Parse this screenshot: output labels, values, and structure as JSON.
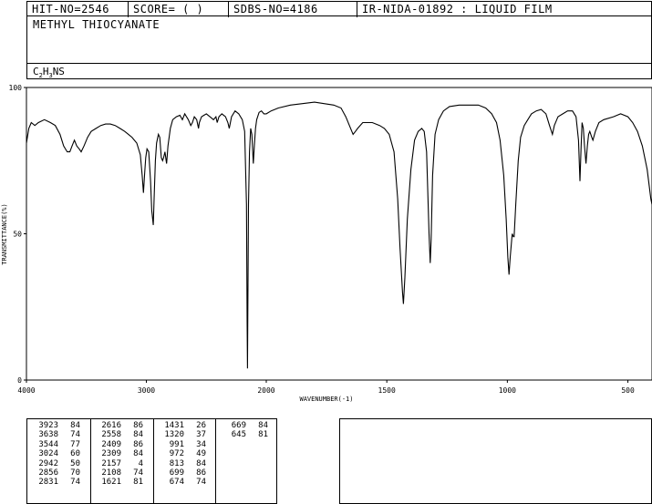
{
  "header": {
    "hit_no": "HIT-NO=2546",
    "score": "SCORE=  (   )",
    "sdbs_no": "SDBS-NO=4186",
    "ir_nida": "IR-NIDA-01892 : LIQUID FILM"
  },
  "compound_name": "METHYL THIOCYANATE",
  "formula": {
    "c": "C",
    "c_sub": "2",
    "h": "H",
    "h_sub": "3",
    "rest": "NS"
  },
  "chart_data": {
    "type": "line",
    "xlabel": "WAVENUMBER(-1)",
    "ylabel": "TRANSMITTANCE(%)",
    "xlim": [
      4000,
      400
    ],
    "ylim": [
      0,
      100
    ],
    "x_ticks": [
      {
        "value": 4000,
        "label": "4000"
      },
      {
        "value": 3000,
        "label": "3000"
      },
      {
        "value": 2000,
        "label": "2000"
      },
      {
        "value": 1500,
        "label": "1500"
      },
      {
        "value": 1000,
        "label": "1000"
      },
      {
        "value": 500,
        "label": "500"
      }
    ],
    "y_ticks": [
      {
        "value": 0,
        "label": "0"
      },
      {
        "value": 50,
        "label": "50"
      },
      {
        "value": 100,
        "label": "100"
      }
    ],
    "scale_note": "x axis: 4000-2000 at half scale of 2000-400",
    "series": [
      {
        "points": [
          [
            4000,
            81
          ],
          [
            3980,
            86
          ],
          [
            3960,
            88
          ],
          [
            3930,
            87
          ],
          [
            3900,
            88
          ],
          [
            3850,
            89
          ],
          [
            3800,
            88
          ],
          [
            3760,
            87
          ],
          [
            3720,
            84
          ],
          [
            3690,
            80
          ],
          [
            3660,
            78
          ],
          [
            3638,
            78
          ],
          [
            3620,
            80
          ],
          [
            3600,
            82
          ],
          [
            3580,
            80
          ],
          [
            3560,
            79
          ],
          [
            3544,
            78
          ],
          [
            3520,
            80
          ],
          [
            3490,
            83
          ],
          [
            3460,
            85
          ],
          [
            3420,
            86
          ],
          [
            3380,
            87
          ],
          [
            3340,
            87.5
          ],
          [
            3300,
            87.5
          ],
          [
            3260,
            87
          ],
          [
            3220,
            86
          ],
          [
            3180,
            85
          ],
          [
            3150,
            84
          ],
          [
            3120,
            83
          ],
          [
            3080,
            81
          ],
          [
            3050,
            77
          ],
          [
            3035,
            70
          ],
          [
            3024,
            64
          ],
          [
            3015,
            70
          ],
          [
            3005,
            76
          ],
          [
            2995,
            79
          ],
          [
            2980,
            78
          ],
          [
            2965,
            68
          ],
          [
            2955,
            58
          ],
          [
            2942,
            53
          ],
          [
            2935,
            62
          ],
          [
            2925,
            75
          ],
          [
            2915,
            81
          ],
          [
            2900,
            84
          ],
          [
            2888,
            83
          ],
          [
            2875,
            76
          ],
          [
            2865,
            75
          ],
          [
            2856,
            76
          ],
          [
            2845,
            78
          ],
          [
            2835,
            75
          ],
          [
            2831,
            74
          ],
          [
            2820,
            80
          ],
          [
            2800,
            86
          ],
          [
            2780,
            89
          ],
          [
            2750,
            90
          ],
          [
            2720,
            90.5
          ],
          [
            2700,
            89
          ],
          [
            2680,
            91
          ],
          [
            2650,
            89
          ],
          [
            2630,
            87
          ],
          [
            2616,
            88
          ],
          [
            2600,
            90
          ],
          [
            2580,
            89
          ],
          [
            2565,
            86
          ],
          [
            2558,
            88
          ],
          [
            2540,
            90
          ],
          [
            2520,
            90.5
          ],
          [
            2500,
            91
          ],
          [
            2470,
            90
          ],
          [
            2440,
            89
          ],
          [
            2420,
            90
          ],
          [
            2409,
            88
          ],
          [
            2395,
            90
          ],
          [
            2370,
            91
          ],
          [
            2340,
            90
          ],
          [
            2320,
            88
          ],
          [
            2309,
            86
          ],
          [
            2290,
            90
          ],
          [
            2260,
            92
          ],
          [
            2230,
            91
          ],
          [
            2200,
            89
          ],
          [
            2180,
            85
          ],
          [
            2165,
            60
          ],
          [
            2160,
            20
          ],
          [
            2157,
            4
          ],
          [
            2154,
            20
          ],
          [
            2148,
            60
          ],
          [
            2140,
            78
          ],
          [
            2130,
            86
          ],
          [
            2120,
            84
          ],
          [
            2108,
            74
          ],
          [
            2100,
            80
          ],
          [
            2090,
            86
          ],
          [
            2080,
            89
          ],
          [
            2060,
            91.5
          ],
          [
            2040,
            92
          ],
          [
            2020,
            91
          ],
          [
            2000,
            91
          ],
          [
            1980,
            92
          ],
          [
            1950,
            93
          ],
          [
            1900,
            94
          ],
          [
            1850,
            94.5
          ],
          [
            1800,
            95
          ],
          [
            1760,
            94.5
          ],
          [
            1720,
            94
          ],
          [
            1690,
            93
          ],
          [
            1670,
            90
          ],
          [
            1650,
            86
          ],
          [
            1640,
            84
          ],
          [
            1630,
            85
          ],
          [
            1621,
            86
          ],
          [
            1600,
            88
          ],
          [
            1560,
            88
          ],
          [
            1530,
            87
          ],
          [
            1510,
            86
          ],
          [
            1490,
            84
          ],
          [
            1470,
            78
          ],
          [
            1455,
            62
          ],
          [
            1445,
            45
          ],
          [
            1435,
            30
          ],
          [
            1431,
            26
          ],
          [
            1425,
            35
          ],
          [
            1415,
            55
          ],
          [
            1400,
            72
          ],
          [
            1385,
            82
          ],
          [
            1370,
            85
          ],
          [
            1355,
            86
          ],
          [
            1345,
            85
          ],
          [
            1335,
            78
          ],
          [
            1325,
            50
          ],
          [
            1320,
            40
          ],
          [
            1316,
            48
          ],
          [
            1310,
            70
          ],
          [
            1300,
            84
          ],
          [
            1285,
            89
          ],
          [
            1265,
            92
          ],
          [
            1240,
            93.5
          ],
          [
            1200,
            94
          ],
          [
            1160,
            94
          ],
          [
            1120,
            94
          ],
          [
            1090,
            93
          ],
          [
            1065,
            91
          ],
          [
            1045,
            88
          ],
          [
            1030,
            82
          ],
          [
            1015,
            70
          ],
          [
            1005,
            55
          ],
          [
            998,
            42
          ],
          [
            993,
            36
          ],
          [
            988,
            42
          ],
          [
            980,
            50
          ],
          [
            975,
            49
          ],
          [
            972,
            49
          ],
          [
            965,
            60
          ],
          [
            955,
            75
          ],
          [
            945,
            83
          ],
          [
            930,
            87
          ],
          [
            915,
            89
          ],
          [
            900,
            91
          ],
          [
            880,
            92
          ],
          [
            860,
            92.5
          ],
          [
            840,
            91
          ],
          [
            825,
            87
          ],
          [
            813,
            84
          ],
          [
            805,
            87
          ],
          [
            790,
            90
          ],
          [
            770,
            91
          ],
          [
            750,
            92
          ],
          [
            730,
            92
          ],
          [
            715,
            90
          ],
          [
            705,
            82
          ],
          [
            699,
            68
          ],
          [
            694,
            80
          ],
          [
            690,
            88
          ],
          [
            685,
            86
          ],
          [
            680,
            80
          ],
          [
            674,
            74
          ],
          [
            668,
            80
          ],
          [
            663,
            84
          ],
          [
            658,
            85
          ],
          [
            650,
            83
          ],
          [
            645,
            82
          ],
          [
            635,
            85
          ],
          [
            620,
            88
          ],
          [
            600,
            89
          ],
          [
            560,
            90
          ],
          [
            530,
            91
          ],
          [
            500,
            90
          ],
          [
            480,
            88
          ],
          [
            460,
            85
          ],
          [
            440,
            80
          ],
          [
            420,
            72
          ],
          [
            405,
            62
          ],
          [
            400,
            60
          ]
        ]
      }
    ]
  },
  "peaks": [
    [
      [
        "3923",
        "84"
      ],
      [
        "3638",
        "74"
      ],
      [
        "3544",
        "77"
      ],
      [
        "3024",
        "60"
      ],
      [
        "2942",
        "50"
      ],
      [
        "2856",
        "70"
      ],
      [
        "2831",
        "74"
      ]
    ],
    [
      [
        "2616",
        "86"
      ],
      [
        "2558",
        "84"
      ],
      [
        "2409",
        "86"
      ],
      [
        "2309",
        "84"
      ],
      [
        "2157",
        "4"
      ],
      [
        "2108",
        "74"
      ],
      [
        "1621",
        "81"
      ]
    ],
    [
      [
        "1431",
        "26"
      ],
      [
        "1320",
        "37"
      ],
      [
        "991",
        "34"
      ],
      [
        "972",
        "49"
      ],
      [
        "813",
        "84"
      ],
      [
        "699",
        "86"
      ],
      [
        "674",
        "74"
      ]
    ],
    [
      [
        "669",
        "84"
      ],
      [
        "645",
        "81"
      ]
    ]
  ]
}
